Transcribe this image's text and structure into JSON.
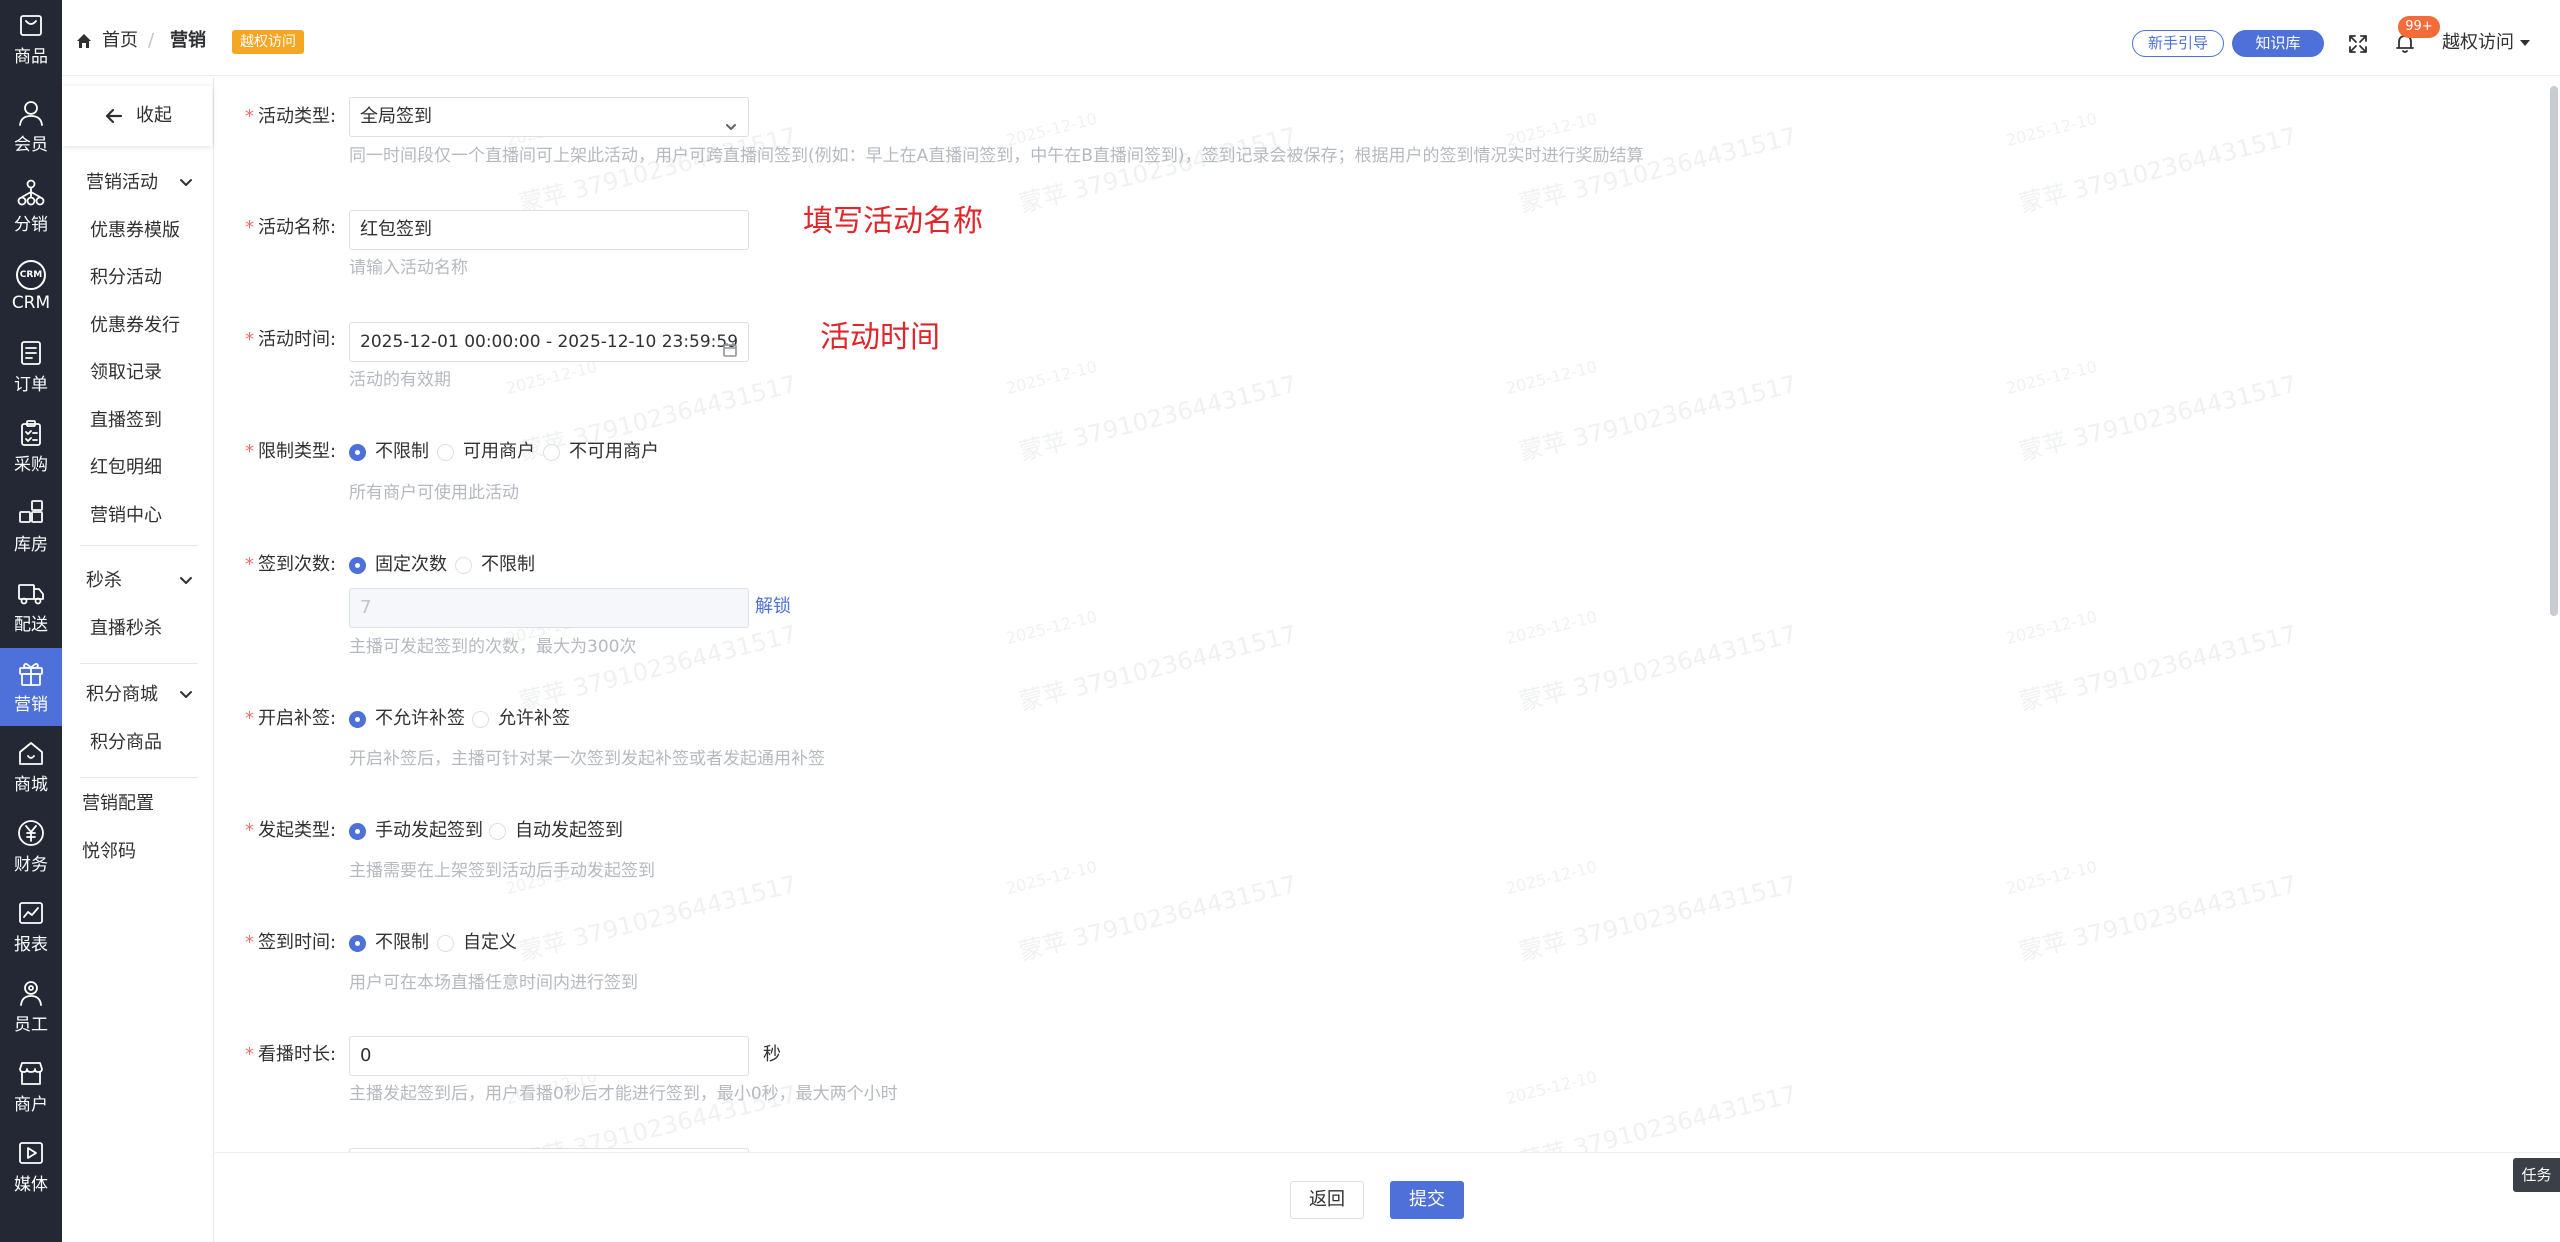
{
  "header": {
    "breadcrumb": {
      "home": "首页",
      "separator": "/",
      "current": "营销"
    },
    "badge": "越权访问",
    "guide_button": "新手引导",
    "kb_button": "知识库",
    "notif_count": "99+",
    "user_name": "越权访问"
  },
  "rail": {
    "items": [
      {
        "label": "商品",
        "icon": "bag-icon"
      },
      {
        "label": "会员",
        "icon": "user-icon"
      },
      {
        "label": "分销",
        "icon": "network-icon"
      },
      {
        "label": "CRM",
        "icon": "crm-icon"
      },
      {
        "label": "订单",
        "icon": "document-icon"
      },
      {
        "label": "采购",
        "icon": "clipboard-icon"
      },
      {
        "label": "库房",
        "icon": "grid-icon"
      },
      {
        "label": "配送",
        "icon": "truck-icon"
      },
      {
        "label": "营销",
        "icon": "gift-icon"
      },
      {
        "label": "商城",
        "icon": "home-icon"
      },
      {
        "label": "财务",
        "icon": "yen-icon"
      },
      {
        "label": "报表",
        "icon": "chart-icon"
      },
      {
        "label": "员工",
        "icon": "employee-icon"
      },
      {
        "label": "商户",
        "icon": "shop-icon"
      },
      {
        "label": "媒体",
        "icon": "play-icon"
      }
    ],
    "active": "营销",
    "crm_badge": "CRM"
  },
  "submenu": {
    "collapse": "收起",
    "group_marketing": "营销活动",
    "marketing_items": [
      "优惠券模版",
      "积分活动",
      "优惠券发行",
      "领取记录",
      "直播签到",
      "红包明细",
      "营销中心"
    ],
    "group_flash": "秒杀",
    "flash_items": [
      "直播秒杀"
    ],
    "group_points": "积分商城",
    "points_items": [
      "积分商品"
    ],
    "config": "营销配置",
    "code": "悦邻码"
  },
  "form": {
    "activity_type": {
      "label": "活动类型:",
      "value": "全局签到",
      "help": "同一时间段仅一个直播间可上架此活动，用户可跨直播间签到(例如：早上在A直播间签到，中午在B直播间签到)，签到记录会被保存；根据用户的签到情况实时进行奖励结算"
    },
    "activity_name": {
      "label": "活动名称:",
      "value": "红包签到",
      "help": "请输入活动名称",
      "annotation": "填写活动名称"
    },
    "activity_time": {
      "label": "活动时间:",
      "value": "2025-12-01 00:00:00 - 2025-12-10 23:59:59",
      "help": "活动的有效期",
      "annotation": "活动时间"
    },
    "limit_type": {
      "label": "限制类型:",
      "options": [
        "不限制",
        "可用商户",
        "不可用商户"
      ],
      "selected": "不限制",
      "help": "所有商户可使用此活动"
    },
    "sign_count": {
      "label": "签到次数:",
      "options": [
        "固定次数",
        "不限制"
      ],
      "selected": "固定次数",
      "value": "7",
      "unlock": "解锁",
      "help": "主播可发起签到的次数，最大为300次"
    },
    "makeup": {
      "label": "开启补签:",
      "options": [
        "不允许补签",
        "允许补签"
      ],
      "selected": "不允许补签",
      "help": "开启补签后，主播可针对某一次签到发起补签或者发起通用补签"
    },
    "launch_type": {
      "label": "发起类型:",
      "options": [
        "手动发起签到",
        "自动发起签到"
      ],
      "selected": "手动发起签到",
      "help": "主播需要在上架签到活动后手动发起签到"
    },
    "sign_time": {
      "label": "签到时间:",
      "options": [
        "不限制",
        "自定义"
      ],
      "selected": "不限制",
      "help": "用户可在本场直播任意时间内进行签到"
    },
    "watch_time": {
      "label": "看播时长:",
      "value": "0",
      "unit": "秒",
      "help": "主播发起签到后，用户看播0秒后才能进行签到，最小0秒，最大两个小时"
    }
  },
  "watermark": {
    "text": "蒙苹 3791023644315​17",
    "date": "2025-12-10"
  },
  "footer": {
    "back": "返回",
    "submit": "提交"
  },
  "task_tab": "任务",
  "colors": {
    "accent": "#4d70d9",
    "rail_bg": "#232834",
    "required": "#f56c6c",
    "annotation": "#e0262b",
    "badge": "#f5a623"
  }
}
